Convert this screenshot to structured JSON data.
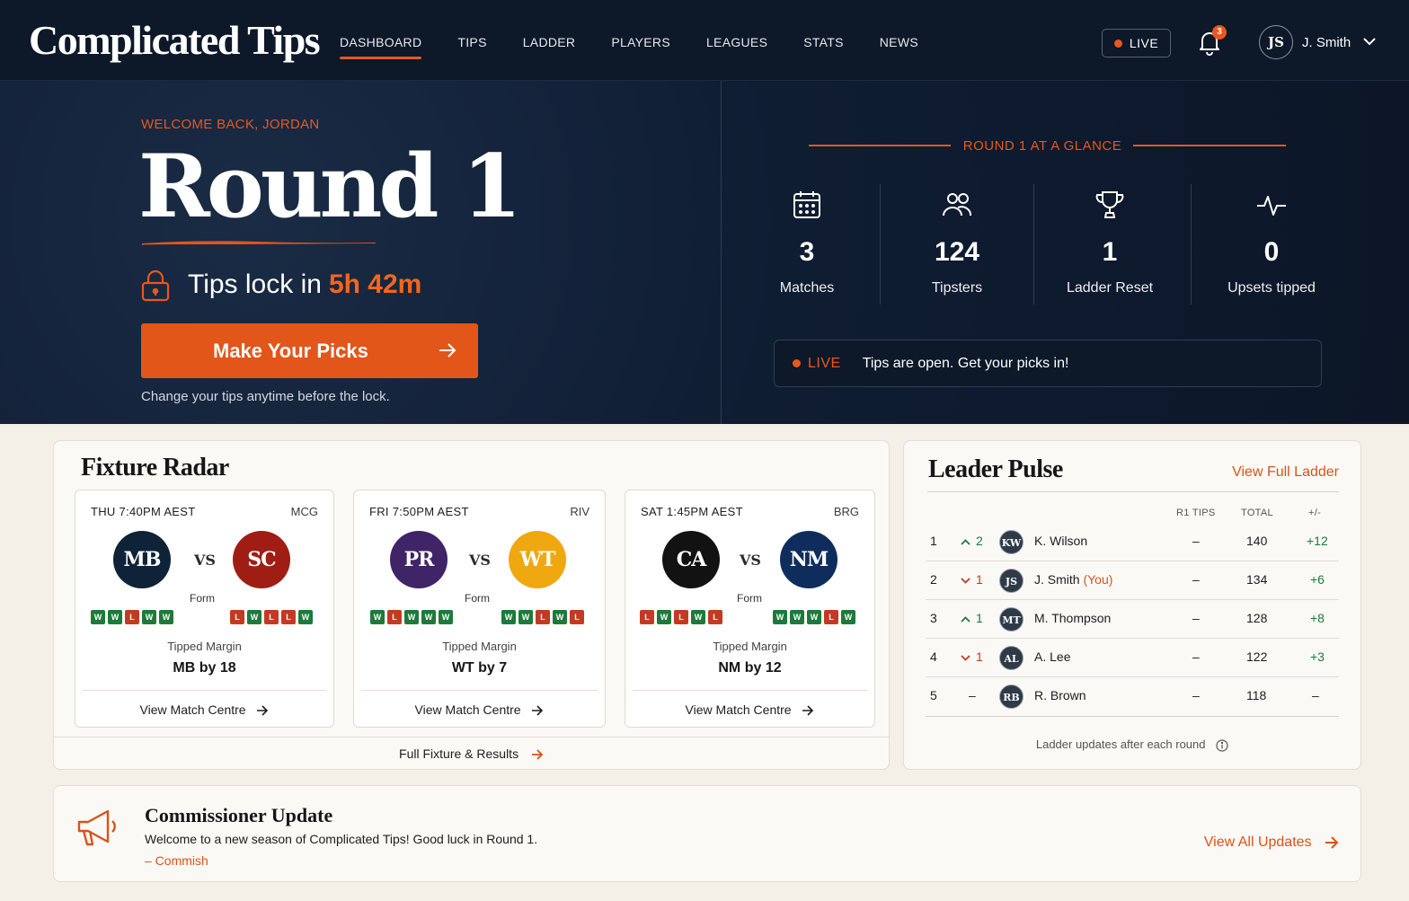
{
  "header": {
    "logo": "Complicated Tips",
    "nav": [
      "DASHBOARD",
      "TIPS",
      "LADDER",
      "PLAYERS",
      "LEAGUES",
      "STATS",
      "NEWS"
    ],
    "live_label": "LIVE",
    "notification_count": "3",
    "user_initials": "JS",
    "user_name": "J. Smith"
  },
  "hero": {
    "welcome": "WELCOME BACK, JORDAN",
    "round_title": "Round 1",
    "lock_text": "Tips lock in",
    "lock_time": "5h 42m",
    "picks_button": "Make Your Picks",
    "change_note": "Change your tips anytime before the lock.",
    "glance_title": "ROUND 1 AT A GLANCE",
    "stats": [
      {
        "value": "3",
        "label": "Matches",
        "icon": "calendar-icon"
      },
      {
        "value": "124",
        "label": "Tipsters",
        "icon": "users-icon"
      },
      {
        "value": "1",
        "label": "Ladder Reset",
        "icon": "trophy-icon"
      },
      {
        "value": "0",
        "label": "Upsets tipped",
        "icon": "pulse-icon"
      }
    ],
    "live_banner_label": "LIVE",
    "live_banner_text": "Tips are open. Get your picks in!"
  },
  "fixture_radar": {
    "title": "Fixture Radar",
    "form_label": "Form",
    "tipped_margin_label": "Tipped Margin",
    "view_match_label": "View Match Centre",
    "vs_label": "VS",
    "full_fixture_label": "Full Fixture & Results",
    "matches": [
      {
        "time": "THU 7:40PM AEST",
        "venue": "MCG",
        "home": {
          "abbr": "MB",
          "color": "#0e2238",
          "form": [
            "W",
            "W",
            "L",
            "W",
            "W"
          ]
        },
        "away": {
          "abbr": "SC",
          "color": "#a01d14",
          "form": [
            "L",
            "W",
            "L",
            "L",
            "W"
          ]
        },
        "tipped": "MB by 18"
      },
      {
        "time": "FRI 7:50PM AEST",
        "venue": "RIV",
        "home": {
          "abbr": "PR",
          "color": "#3f2468",
          "form": [
            "W",
            "L",
            "W",
            "W",
            "W"
          ]
        },
        "away": {
          "abbr": "WT",
          "color": "#f0a811",
          "form": [
            "W",
            "W",
            "L",
            "W",
            "L"
          ]
        },
        "tipped": "WT by 7"
      },
      {
        "time": "SAT 1:45PM AEST",
        "venue": "BRG",
        "home": {
          "abbr": "CA",
          "color": "#121212",
          "form": [
            "L",
            "W",
            "L",
            "W",
            "L"
          ]
        },
        "away": {
          "abbr": "NM",
          "color": "#0f2d5c",
          "form": [
            "W",
            "W",
            "W",
            "L",
            "W"
          ]
        },
        "tipped": "NM by 12"
      }
    ]
  },
  "leader_pulse": {
    "title": "Leader Pulse",
    "view_full": "View Full Ladder",
    "columns": [
      "R1 TIPS",
      "TOTAL",
      "+/-"
    ],
    "rows": [
      {
        "rank": "1",
        "move": "2",
        "dir": "up",
        "initials": "KW",
        "name": "K. Wilson",
        "you": "",
        "r1": "–",
        "total": "140",
        "diff": "+12"
      },
      {
        "rank": "2",
        "move": "1",
        "dir": "down",
        "initials": "JS",
        "name": "J. Smith",
        "you": "(You)",
        "r1": "–",
        "total": "134",
        "diff": "+6"
      },
      {
        "rank": "3",
        "move": "1",
        "dir": "up",
        "initials": "MT",
        "name": "M. Thompson",
        "you": "",
        "r1": "–",
        "total": "128",
        "diff": "+8"
      },
      {
        "rank": "4",
        "move": "1",
        "dir": "down",
        "initials": "AL",
        "name": "A. Lee",
        "you": "",
        "r1": "–",
        "total": "122",
        "diff": "+3"
      },
      {
        "rank": "5",
        "move": "–",
        "dir": "none",
        "initials": "RB",
        "name": "R. Brown",
        "you": "",
        "r1": "–",
        "total": "118",
        "diff": "–"
      }
    ],
    "footer": "Ladder updates after each round"
  },
  "commissioner": {
    "title": "Commissioner Update",
    "text": "Welcome to a new season of Complicated Tips! Good luck in Round 1.",
    "signature": "– Commish",
    "link": "View All Updates"
  },
  "colors": {
    "accent": "#e8581c",
    "navy": "#0d1829",
    "win": "#1d7a3a",
    "loss": "#c23a22"
  }
}
